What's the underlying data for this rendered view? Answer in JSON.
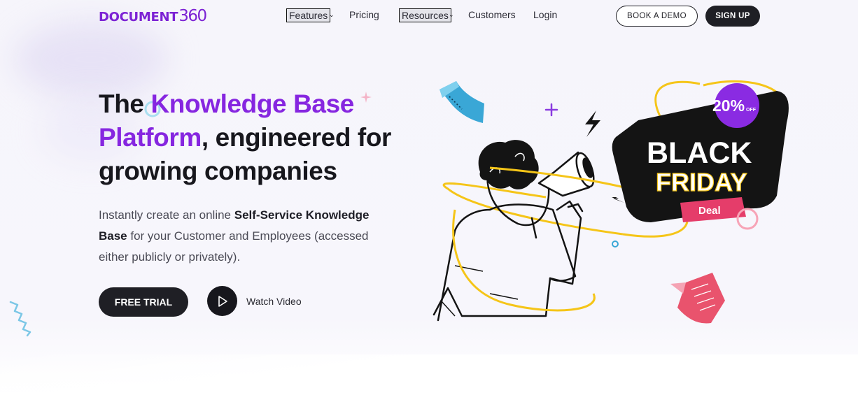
{
  "nav": {
    "logo_word": "DOCUMENT",
    "logo_num": "360",
    "features": "Features",
    "pricing": "Pricing",
    "resources": "Resources",
    "customers": "Customers",
    "login": "Login",
    "book_demo": "BOOK A DEMO",
    "sign_up": "SIGN UP"
  },
  "hero": {
    "headline_part1": "The ",
    "headline_accent": "Knowledge Base Platform",
    "headline_part2": ", engineered for growing companies",
    "sub_part1": "Instantly create an online ",
    "sub_bold1": "Self-Service Knowledge Base",
    "sub_part2": " for your Customer and Employees (accessed either publicly or privately).",
    "free_trial": "FREE TRIAL",
    "watch_video": "Watch Video"
  },
  "promo": {
    "discount": "20%",
    "discount_off": "OFF",
    "line1": "BLACK",
    "line2": "FRIDAY",
    "deal": "Deal"
  },
  "colors": {
    "brand_purple": "#7c22d4",
    "accent_purple": "#8626e0",
    "dark": "#1f1f25",
    "ribbon_pink": "#e53d6a",
    "ring_yellow": "#f5c518"
  },
  "icons": {
    "chevron": "chevron-down-icon",
    "play": "play-icon"
  }
}
